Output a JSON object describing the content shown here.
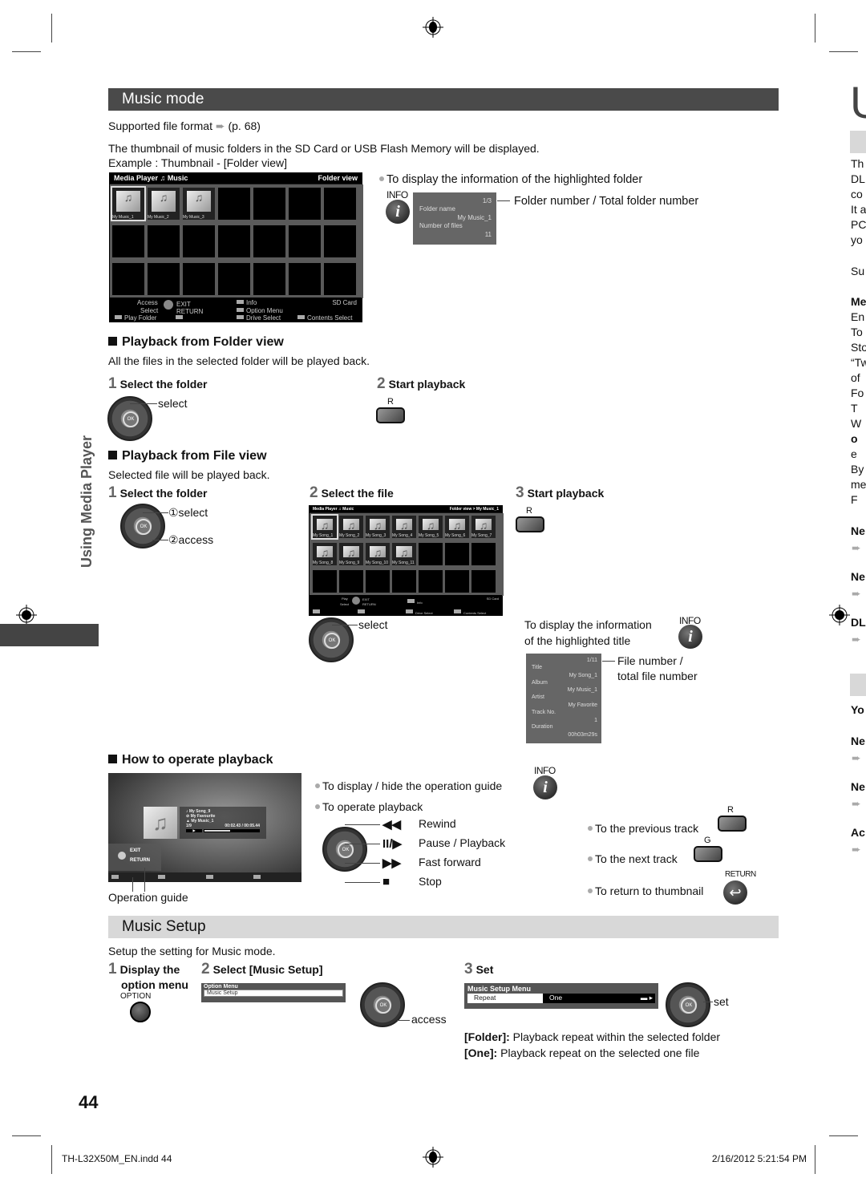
{
  "side_tab": {
    "title": "Using Media Player"
  },
  "music_mode": {
    "title": "Music mode",
    "supported_format": "Supported file format",
    "supported_ref": "(p. 68)",
    "intro": "The thumbnail of music folders in the SD Card or USB Flash Memory will be displayed.",
    "example": "Example : Thumbnail - [Folder view]",
    "folder_screen": {
      "left_title": "Media Player",
      "mode": "Music",
      "right_title": "Folder view",
      "folders": [
        "My Music_1",
        "My Music_2",
        "My Music_3"
      ],
      "footer": {
        "access": "Access",
        "select": "Select",
        "exit": "EXIT",
        "return": "RETURN",
        "info": "Info",
        "option_menu": "Option Menu",
        "drive": "SD Card",
        "play_folder": "Play Folder",
        "drive_select": "Drive Select",
        "contents_select": "Contents Select"
      }
    },
    "folder_info": {
      "bullet": "To display the information of the highlighted folder",
      "info_label": "INFO",
      "counter": "1/3",
      "folder_name_label": "Folder name",
      "folder_name": "My Music_1",
      "files_label": "Number of files",
      "files": "11",
      "callout": "Folder number / Total folder number"
    }
  },
  "folder_view": {
    "heading": "Playback from Folder view",
    "desc": "All the files in the selected folder will be played back.",
    "step1_num": "1",
    "step1": "Select the folder",
    "step1_select": "select",
    "step2_num": "2",
    "step2": "Start playback",
    "step2_key": "R"
  },
  "file_view": {
    "heading": "Playback from File view",
    "desc": "Selected file will be played back.",
    "step1_num": "1",
    "step1": "Select the folder",
    "step1_select": "①select",
    "step1_access": "②access",
    "step2_num": "2",
    "step2": "Select the file",
    "step2_select": "select",
    "step3_num": "3",
    "step3": "Start playback",
    "step3_key": "R",
    "file_screen": {
      "left_title": "Media Player",
      "mode": "Music",
      "right_title": "Folder view > My Music_1",
      "files": [
        "My Song_1",
        "My Song_2",
        "My Song_3",
        "My Song_4",
        "My Song_5",
        "My Song_6",
        "My Song_7",
        "My Song_8",
        "My Song_9",
        "My Song_10",
        "My Song_11"
      ],
      "footer": {
        "play": "Play",
        "select": "Select",
        "exit": "EXIT",
        "return": "RETURN",
        "info": "Info",
        "drive": "SD Card",
        "drive_select": "Drive Select",
        "contents_select": "Contents Select"
      }
    },
    "title_info": {
      "desc_line1": "To display the information",
      "desc_line2": "of the highlighted title",
      "info_label": "INFO",
      "counter": "1/11",
      "title_label": "Title",
      "title": "My Song_1",
      "album_label": "Album",
      "album": "My Music_1",
      "artist_label": "Artist",
      "artist": "My Favorite",
      "track_label": "Track No.",
      "track": "1",
      "duration_label": "Duration",
      "duration": "00h03m29s",
      "callout_line1": "File number /",
      "callout_line2": "total file number"
    }
  },
  "operate": {
    "heading": "How to operate playback",
    "player": {
      "song": "My Song_9",
      "artist": "My Favourite",
      "album": "My Music_1",
      "track": "1/9",
      "time": "00:02.43 / 00:05.44",
      "progress": 0.45,
      "exit": "EXIT",
      "return": "RETURN"
    },
    "operation_guide": "Operation guide",
    "toggle_guide": "To display / hide the operation guide",
    "info_label": "INFO",
    "operate_label": "To operate playback",
    "controls": [
      {
        "symbol": "◀◀",
        "label": "Rewind"
      },
      {
        "symbol": "II/▶",
        "label": "Pause / Playback"
      },
      {
        "symbol": "▶▶",
        "label": "Fast forward"
      },
      {
        "symbol": "■",
        "label": "Stop"
      }
    ],
    "prev_track": "To the previous track",
    "prev_key": "R",
    "next_track": "To the next track",
    "next_key": "G",
    "return_thumb": "To return to thumbnail",
    "return_label": "RETURN"
  },
  "music_setup": {
    "title": "Music Setup",
    "desc": "Setup the setting for Music mode.",
    "step1_num": "1",
    "step1_line1": "Display the",
    "step1_line2": "option menu",
    "option_label": "OPTION",
    "step2_num": "2",
    "step2": "Select [Music Setup]",
    "option_menu_title": "Option Menu",
    "option_menu_item": "Music Setup",
    "access": "access",
    "step3_num": "3",
    "step3": "Set",
    "setup_menu_title": "Music Setup Menu",
    "repeat_label": "Repeat",
    "repeat_value": "One",
    "set": "set",
    "folder_opt": "[Folder]:",
    "folder_desc": " Playback repeat within the selected folder",
    "one_opt": "[One]:",
    "one_desc": " Playback repeat on the selected one file"
  },
  "page_number": "44",
  "footer": {
    "file": "TH-L32X50M_EN.indd   44",
    "timestamp": "2/16/2012   5:21:54 PM"
  },
  "right_column_fragments": {
    "big_letter": "U",
    "lines": [
      "Th",
      "DL",
      "co",
      "It a",
      "PC",
      "yo",
      "Su",
      "Me",
      "En",
      "To",
      "Sto",
      "“Tw",
      "of",
      "Fo",
      "T",
      "W",
      "o",
      "e",
      "By",
      "me",
      "F"
    ],
    "subheads": [
      "Ne",
      "Ne",
      "DL",
      "Yo",
      "Ne",
      "Ne",
      "Ac"
    ]
  }
}
